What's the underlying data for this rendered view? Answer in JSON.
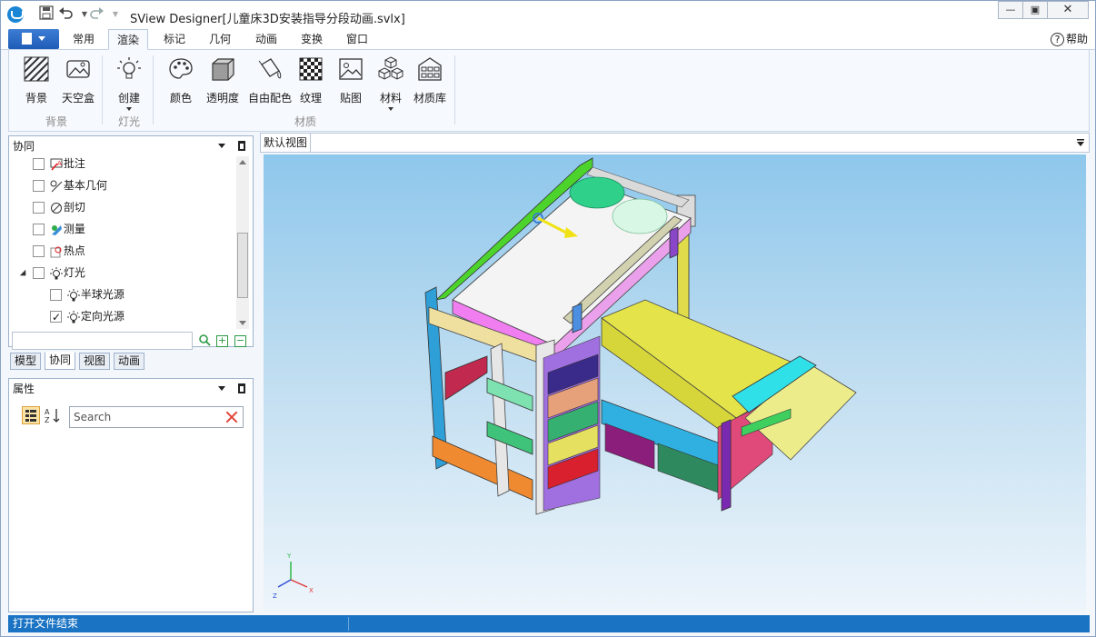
{
  "window": {
    "title": "SView Designer[儿童床3D安装指导分段动画.svlx]",
    "minimize_icon": "minimize-icon",
    "maximize_icon": "maximize-icon",
    "close_icon": "close-icon"
  },
  "quick_access": [
    "save-icon",
    "undo-icon",
    "redo-icon"
  ],
  "menu": {
    "tabs": [
      "常用",
      "渲染",
      "标记",
      "几何",
      "动画",
      "变换",
      "窗口"
    ],
    "active_tab": "渲染",
    "help": "帮助"
  },
  "ribbon": {
    "buttons": [
      {
        "label": "背景",
        "icon": "background-hatch-icon"
      },
      {
        "label": "天空盒",
        "icon": "skybox-icon"
      },
      {
        "label": "创建",
        "icon": "light-bulb-icon"
      },
      {
        "label": "颜色",
        "icon": "palette-icon"
      },
      {
        "label": "透明度",
        "icon": "transparency-cube-icon"
      },
      {
        "label": "自由配色",
        "icon": "paint-bucket-icon"
      },
      {
        "label": "纹理",
        "icon": "checker-texture-icon"
      },
      {
        "label": "贴图",
        "icon": "image-map-icon"
      },
      {
        "label": "材料",
        "icon": "material-cubes-icon"
      },
      {
        "label": "材质库",
        "icon": "material-library-icon"
      }
    ],
    "groups": [
      "背景",
      "灯光",
      "材质"
    ]
  },
  "cooperation_panel": {
    "title": "协同",
    "items": [
      {
        "label": "批注",
        "checked": false,
        "icon": "annotation-icon"
      },
      {
        "label": "基本几何",
        "checked": false,
        "icon": "basic-geometry-icon"
      },
      {
        "label": "剖切",
        "checked": false,
        "icon": "section-icon"
      },
      {
        "label": "测量",
        "checked": false,
        "icon": "measure-icon"
      },
      {
        "label": "热点",
        "checked": false,
        "icon": "hotspot-icon"
      },
      {
        "label": "灯光",
        "checked": false,
        "icon": "light-icon"
      },
      {
        "label": "半球光源",
        "checked": false,
        "icon": "hemisphere-light-icon"
      },
      {
        "label": "定向光源",
        "checked": true,
        "icon": "directional-light-icon"
      }
    ],
    "bottom_tabs": [
      "模型",
      "协同",
      "视图",
      "动画"
    ],
    "active_bottom_tab": "协同"
  },
  "properties_panel": {
    "title": "属性",
    "search_placeholder": "Search"
  },
  "view": {
    "tab_label": "默认视图",
    "axis_labels": {
      "x": "X",
      "y": "Y",
      "z": "Z"
    }
  },
  "status": {
    "message": "打开文件结束"
  },
  "colors": {
    "accent": "#1a73c3",
    "viewport_top": "#8ec7ec",
    "viewport_bottom": "#eef5fb"
  }
}
